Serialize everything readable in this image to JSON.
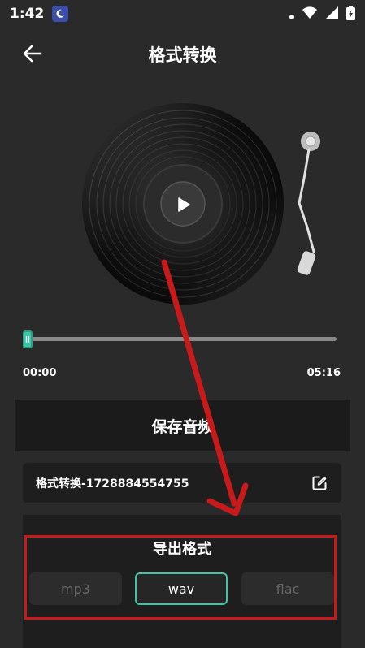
{
  "status_bar": {
    "time": "1:42"
  },
  "header": {
    "title": "格式转换"
  },
  "player": {
    "current_time": "00:00",
    "total_time": "05:16",
    "progress": 0.0
  },
  "save_button": {
    "label": "保存音频"
  },
  "file": {
    "name": "格式转换-1728884554755"
  },
  "export": {
    "title": "导出格式",
    "formats": [
      {
        "label": "mp3",
        "selected": false
      },
      {
        "label": "wav",
        "selected": true
      },
      {
        "label": "flac",
        "selected": false
      }
    ]
  },
  "colors": {
    "accent": "#3cc6a6",
    "annotation": "#c8191b",
    "background": "#2a2a2a"
  }
}
